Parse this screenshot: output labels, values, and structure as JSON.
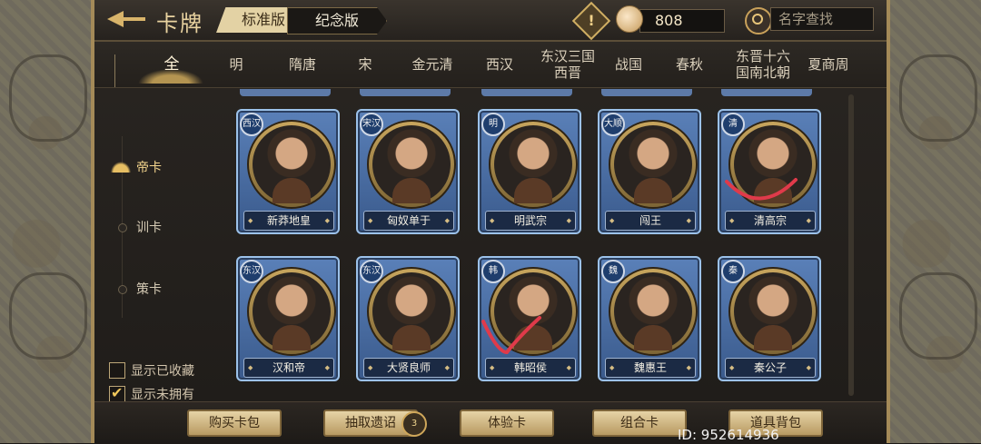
{
  "header": {
    "title": "卡牌",
    "version_tabs": [
      "标准版",
      "纪念版"
    ],
    "currency_value": "808",
    "search_placeholder": "名字查找",
    "warn_symbol": "!"
  },
  "era_tabs": [
    "全",
    "明",
    "隋唐",
    "宋",
    "金元清",
    "西汉",
    "东汉三国西晋",
    "战国",
    "春秋",
    "东晋十六国南北朝",
    "夏商周"
  ],
  "era_tab_lines": [
    [
      "全"
    ],
    [
      "明"
    ],
    [
      "隋唐"
    ],
    [
      "宋"
    ],
    [
      "金元清"
    ],
    [
      "西汉"
    ],
    [
      "东汉三国",
      "西晋"
    ],
    [
      "战国"
    ],
    [
      "春秋"
    ],
    [
      "东晋十六",
      "国南北朝"
    ],
    [
      "夏商周"
    ]
  ],
  "categories": [
    {
      "label": "帝卡",
      "active": true
    },
    {
      "label": "训卡",
      "active": false
    },
    {
      "label": "策卡",
      "active": false
    }
  ],
  "filters": [
    {
      "label": "显示已收藏",
      "checked": false
    },
    {
      "label": "显示未拥有",
      "checked": true
    }
  ],
  "cards": [
    {
      "name": "新莽地皇",
      "badge": "西汉"
    },
    {
      "name": "匈奴单于",
      "badge": "宋汉"
    },
    {
      "name": "明武宗",
      "badge": "明"
    },
    {
      "name": "闯王",
      "badge": "大顺"
    },
    {
      "name": "清高宗",
      "badge": "清"
    },
    {
      "name": "汉和帝",
      "badge": "东汉"
    },
    {
      "name": "大贤良师",
      "badge": "东汉"
    },
    {
      "name": "韩昭侯",
      "badge": "韩"
    },
    {
      "name": "魏惠王",
      "badge": "魏"
    },
    {
      "name": "秦公子",
      "badge": "秦"
    }
  ],
  "bottom_buttons": [
    "购买卡包",
    "抽取遗诏",
    "体验卡",
    "组合卡",
    "道具背包"
  ],
  "draw_badge": "3",
  "id_text": "ID: 952614936",
  "colors": {
    "accent_gold": "#d8b46a",
    "card_blue": "#5a80b8",
    "mark_red": "#e03a4a"
  }
}
